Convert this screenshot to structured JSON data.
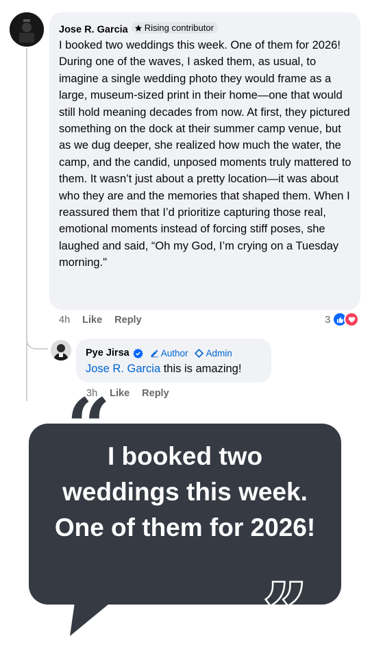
{
  "comment": {
    "author": "Jose R. Garcia",
    "badge": "Rising contributor",
    "body": "I booked two weddings this week. One of them for 2026! During one of the waves, I asked them, as usual, to imagine a single wedding photo they would frame as a large, museum-sized print in their home—one that would still hold meaning decades from now. At first, they pictured something on the dock at their summer camp venue, but as we dug deeper, she realized how much the water, the camp, and the candid, unposed moments truly mattered to them. It wasn’t just about a pretty location—it was about who they are and the memories that shaped them. When I reassured them that I’d prioritize capturing those real, emotional moments instead of forcing stiff poses, she laughed and said, “Oh my God, I’m crying on a Tuesday morning.\"",
    "time": "4h",
    "like": "Like",
    "reply": "Reply",
    "reaction_count": "3",
    "reactions": [
      "like",
      "love"
    ]
  },
  "reply": {
    "author": "Pye Jirsa",
    "verified": true,
    "roles": [
      {
        "label": "Author",
        "icon": "pencil-icon"
      },
      {
        "label": "Admin",
        "icon": "diamond-icon"
      }
    ],
    "mention": "Jose R. Garcia",
    "text": " this is amazing!",
    "time": "3h",
    "like": "Like",
    "reply": "Reply"
  },
  "quote_card": {
    "text": "I booked two weddings this week. One of them for 2026!",
    "open_quote": "“",
    "close_quote": "”"
  },
  "colors": {
    "accent": "#0866ff",
    "quote_bg": "#353a43",
    "bubble_bg": "#f0f2f5",
    "love": "#f33e58"
  }
}
